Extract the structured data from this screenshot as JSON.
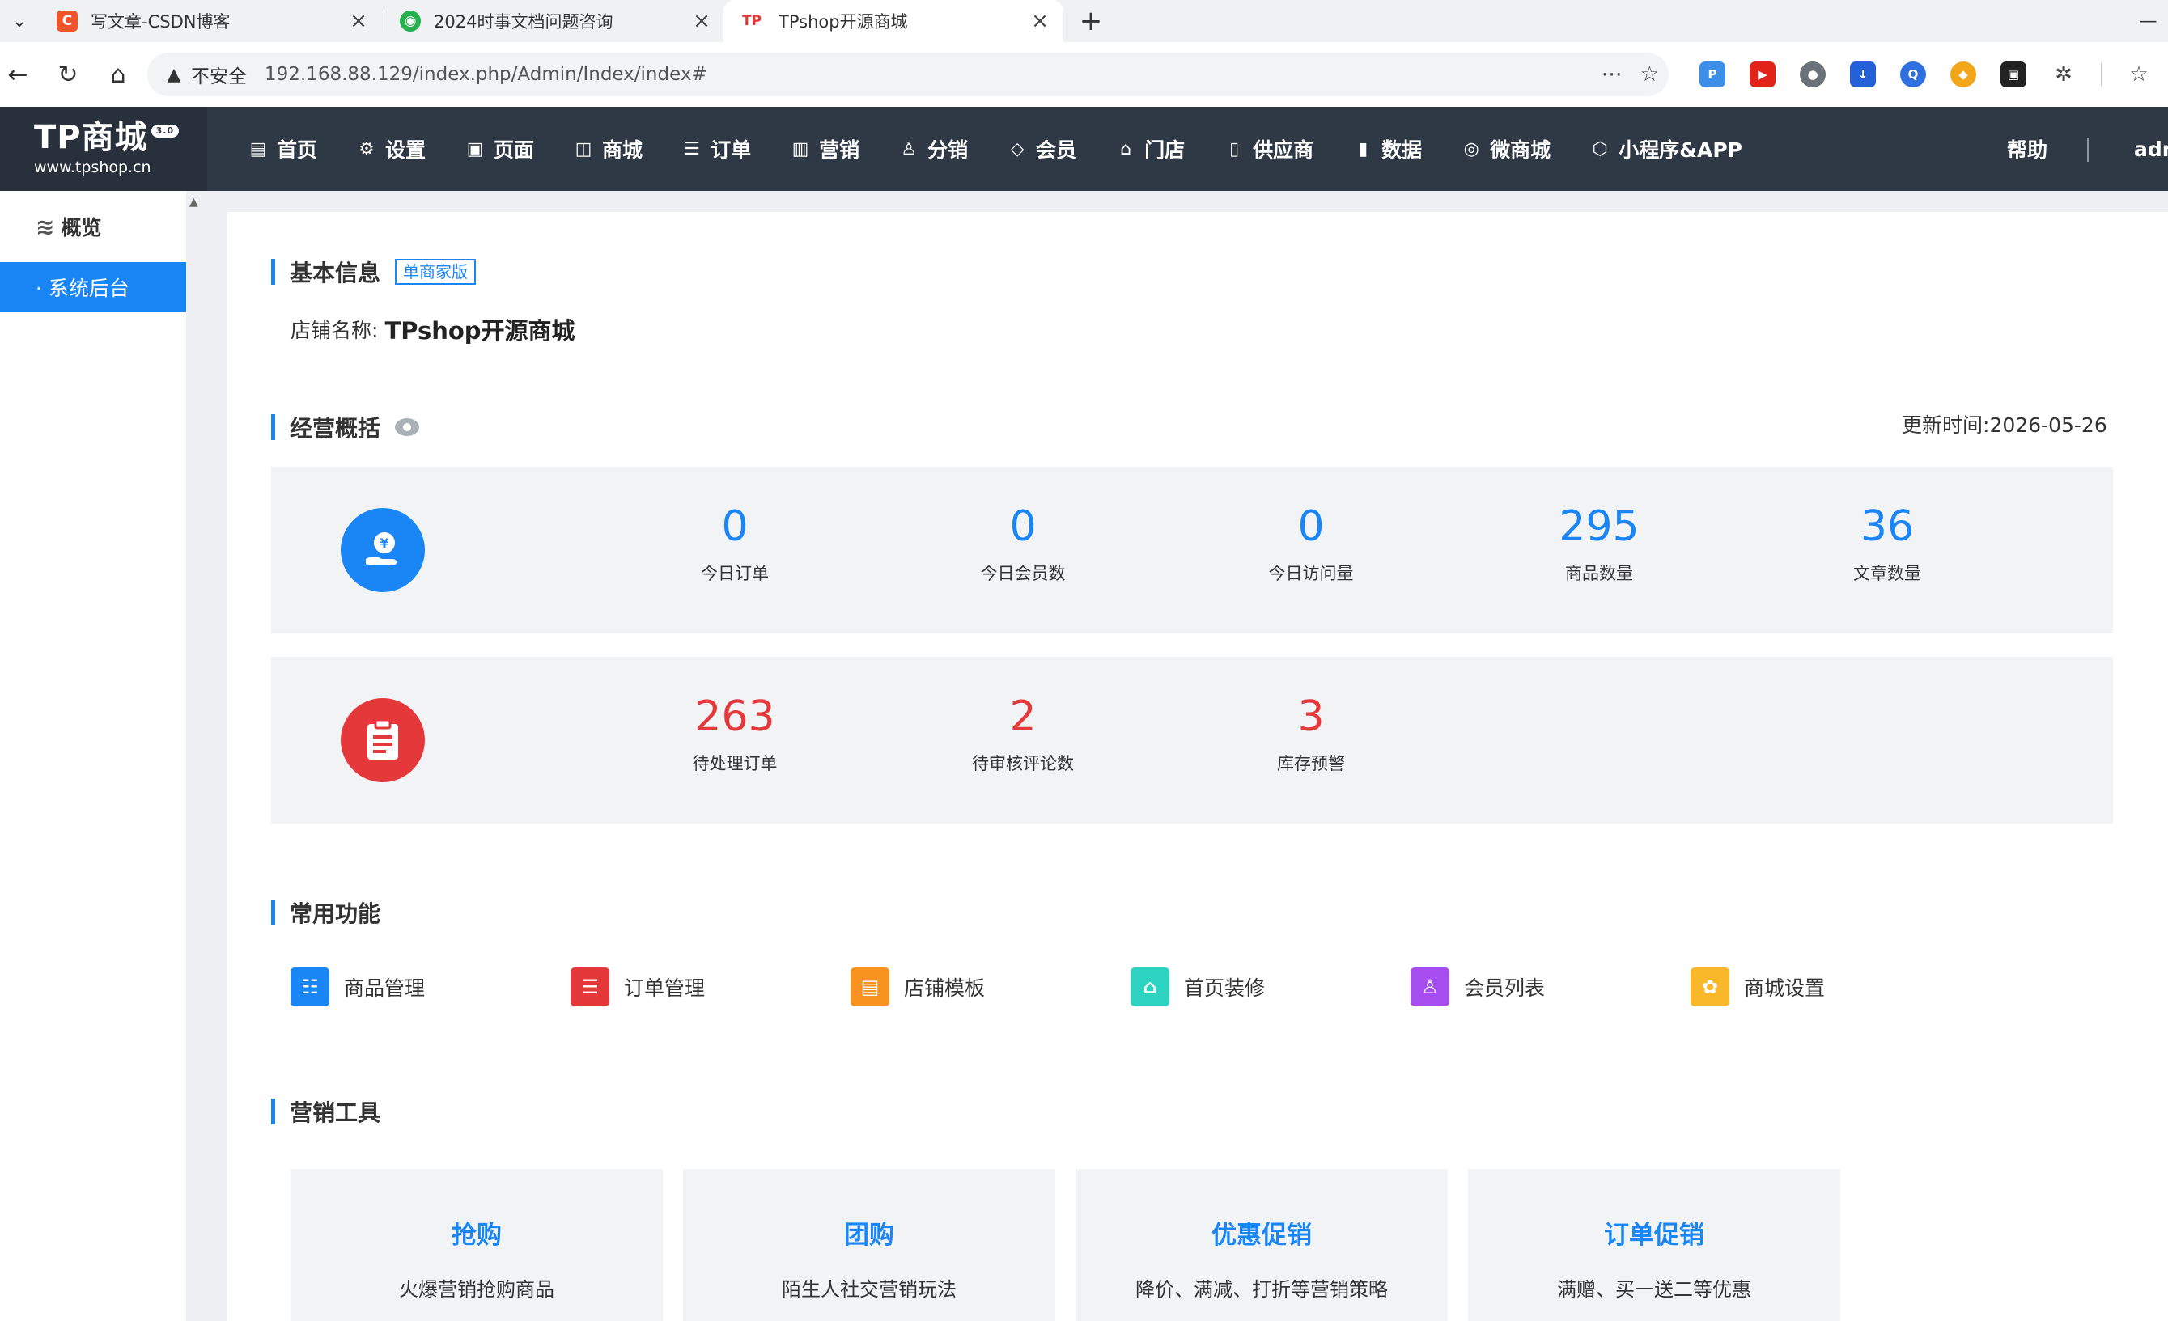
{
  "browser": {
    "tabs": [
      {
        "title": "写文章-CSDN博客",
        "favicon": "C",
        "color": "#f0542d"
      },
      {
        "title": "2024时事文档问题咨询",
        "favicon": "◉",
        "color": "#22b14c"
      },
      {
        "title": "TPshop开源商城",
        "favicon": "TP",
        "color": "#e5383b"
      }
    ],
    "not_secure": "不安全",
    "url": "192.168.88.129/index.php/Admin/Index/index#"
  },
  "header": {
    "logo_text": "TP商城",
    "logo_version": "3.0",
    "logo_url": "www.tpshop.cn",
    "nav": [
      "首页",
      "设置",
      "页面",
      "商城",
      "订单",
      "营销",
      "分销",
      "会员",
      "门店",
      "供应商",
      "数据",
      "微商城",
      "小程序&APP"
    ],
    "help": "帮助",
    "user": "admin"
  },
  "sidebar": {
    "group": "概览",
    "items": [
      "· 系统后台"
    ]
  },
  "basic_info": {
    "title": "基本信息",
    "badge": "单商家版",
    "store_label": "店铺名称:",
    "store_name": "TPshop开源商城"
  },
  "overview": {
    "title": "经营概括",
    "updated_label": "更新时间:",
    "updated_date": "2026-05-26",
    "row1": [
      {
        "value": "0",
        "label": "今日订单"
      },
      {
        "value": "0",
        "label": "今日会员数"
      },
      {
        "value": "0",
        "label": "今日访问量"
      },
      {
        "value": "295",
        "label": "商品数量"
      },
      {
        "value": "36",
        "label": "文章数量"
      }
    ],
    "row2": [
      {
        "value": "263",
        "label": "待处理订单"
      },
      {
        "value": "2",
        "label": "待审核评论数"
      },
      {
        "value": "3",
        "label": "库存预警"
      }
    ]
  },
  "common": {
    "title": "常用功能",
    "items": [
      {
        "label": "商品管理",
        "color": "#1a86f5"
      },
      {
        "label": "订单管理",
        "color": "#e5383b"
      },
      {
        "label": "店铺模板",
        "color": "#f7931e"
      },
      {
        "label": "首页装修",
        "color": "#2ed2c0"
      },
      {
        "label": "会员列表",
        "color": "#a64df0"
      },
      {
        "label": "商城设置",
        "color": "#f8b82a"
      }
    ]
  },
  "marketing": {
    "title": "营销工具",
    "cards": [
      {
        "title": "抢购",
        "desc": "火爆营销抢购商品"
      },
      {
        "title": "团购",
        "desc": "陌生人社交营销玩法"
      },
      {
        "title": "优惠促销",
        "desc": "降价、满减、打折等营销策略"
      },
      {
        "title": "订单促销",
        "desc": "满赠、买一送二等优惠"
      }
    ]
  }
}
